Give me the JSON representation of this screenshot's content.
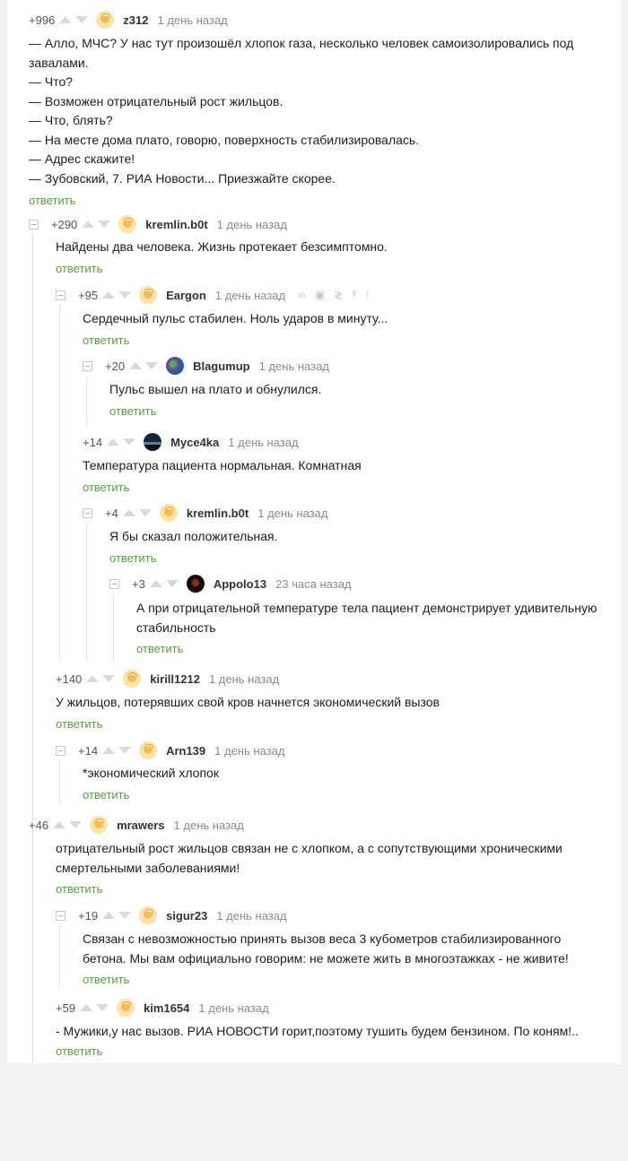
{
  "reply_label": "ответить",
  "comments": [
    {
      "rating": "+996",
      "nick": "z312",
      "time": "1 день назад",
      "lines": [
        "— Алло, МЧС? У нас тут произошёл хлопок газа, несколько человек самоизолировались под",
        "завалами.",
        "— Что?",
        "— Возможен отрицательный рост жильцов.",
        "— Что, блять?",
        "— На месте дома плато, говорю, поверхность стабилизировалась.",
        "— Адрес скажите!",
        "— Зубовский, 7. РИА Новости... Приезжайте скорее."
      ]
    },
    {
      "rating": "+290",
      "nick": "kremlin.b0t",
      "time": "1 день назад",
      "lines": [
        "Найдены два человека. Жизнь протекает безсимптомно."
      ]
    },
    {
      "rating": "+95",
      "nick": "Eargon",
      "time": "1 день назад",
      "lines": [
        "Сердечный пульс стабилен. Ноль ударов в минуту..."
      ]
    },
    {
      "rating": "+20",
      "nick": "Blagumup",
      "time": "1 день назад",
      "lines": [
        "Пульс вышел на плато и обнулился."
      ]
    },
    {
      "rating": "+14",
      "nick": "Myce4ka",
      "time": "1 день назад",
      "lines": [
        "Температура пациента нормальная. Комнатная"
      ]
    },
    {
      "rating": "+4",
      "nick": "kremlin.b0t",
      "time": "1 день назад",
      "lines": [
        "Я бы сказал положительная."
      ]
    },
    {
      "rating": "+3",
      "nick": "Appolo13",
      "time": "23 часа назад",
      "lines": [
        "А при отрицательной температуре тела пациент демонстрирует удивительную",
        "стабильность"
      ]
    },
    {
      "rating": "+140",
      "nick": "kirill1212",
      "time": "1 день назад",
      "lines": [
        "У жильцов, потерявших свой кров начнется экономический вызов"
      ]
    },
    {
      "rating": "+14",
      "nick": "Arn139",
      "time": "1 день назад",
      "lines": [
        "*экономический хлопок"
      ]
    },
    {
      "rating": "+46",
      "nick": "mrawers",
      "time": "1 день назад",
      "lines": [
        "отрицательный рост жильцов связан не с хлопком, а с сопутствующими хроническими",
        "смертельными заболеваниями!"
      ]
    },
    {
      "rating": "+19",
      "nick": "sigur23",
      "time": "1 день назад",
      "lines": [
        "Связан с невозможностью принять вызов веса 3 кубометров стабилизированного",
        "бетона. Мы вам официально говорим: не можете жить в многоэтажках - не живите!"
      ]
    },
    {
      "rating": "+59",
      "nick": "kim1654",
      "time": "1 день назад",
      "lines": [
        "- Мужики,у нас вызов. РИА НОВОСТИ горит,поэтому тушить будем бензином. По коням!.."
      ]
    }
  ],
  "icons": {
    "link": "link-icon",
    "save": "save-icon",
    "share": "share-icon",
    "up": "scroll-up-icon",
    "more": "more-icon"
  }
}
